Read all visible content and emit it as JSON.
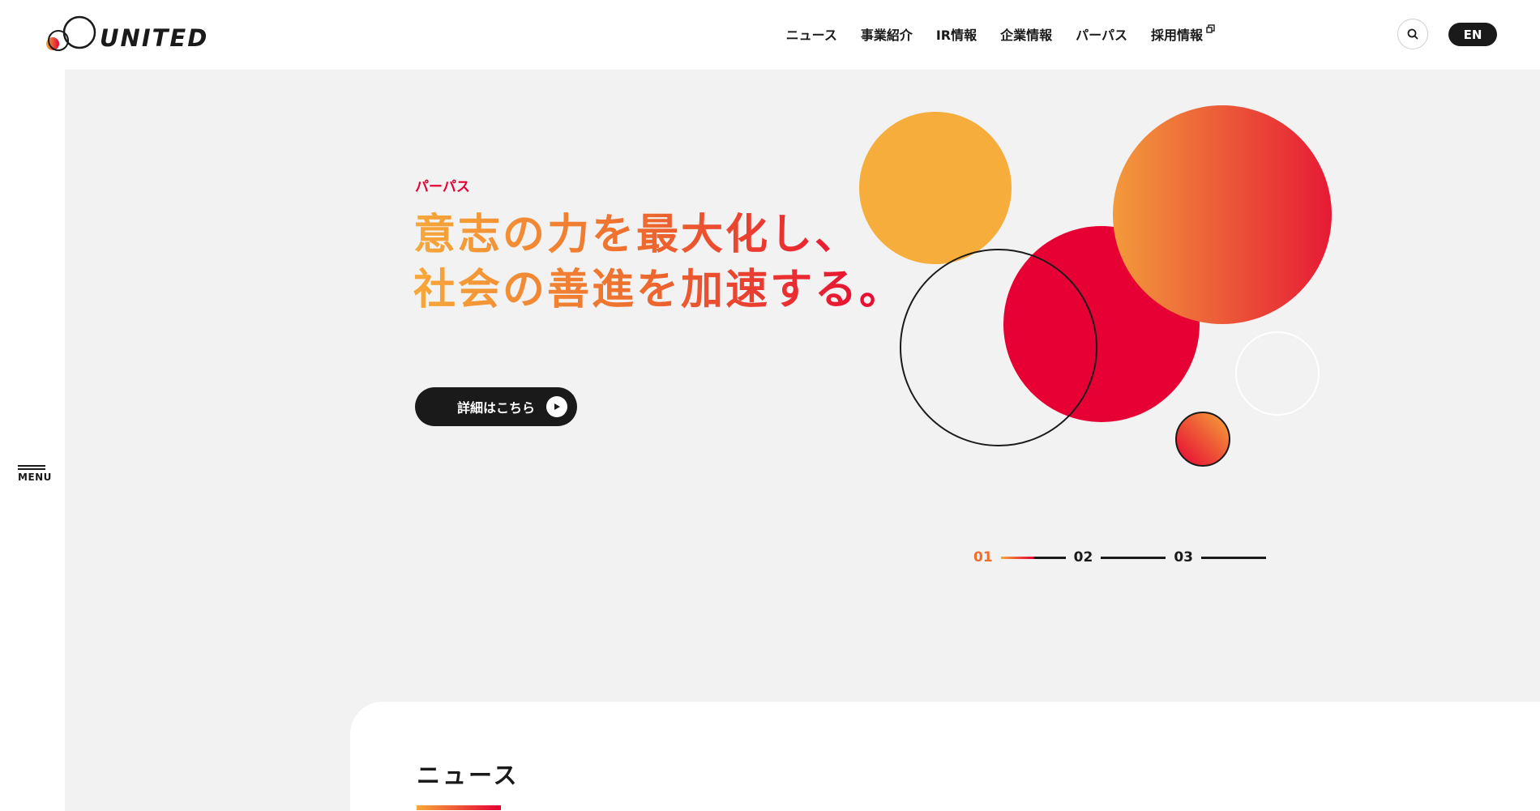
{
  "brand": {
    "logo_text": "UNITED"
  },
  "nav": {
    "items": [
      {
        "label": "ニュース"
      },
      {
        "label": "事業紹介"
      },
      {
        "label": "IR情報"
      },
      {
        "label": "企業情報"
      },
      {
        "label": "パーパス"
      },
      {
        "label": "採用情報",
        "external": true
      }
    ],
    "search_icon": "search-icon",
    "lang_label": "EN"
  },
  "sidebar": {
    "menu_label": "MENU"
  },
  "hero": {
    "eyebrow": "パーパス",
    "headline_line1": "意志の力を最大化し、",
    "headline_line2": "社会の善進を加速する。",
    "cta_label": "詳細はこちら",
    "slides": [
      "01",
      "02",
      "03"
    ],
    "active_slide": "01"
  },
  "news": {
    "title": "ニュース"
  },
  "colors": {
    "accent_red": "#e60033",
    "accent_orange": "#f6a83a",
    "dark": "#1a1a1a",
    "hero_bg": "#f2f2f2"
  }
}
